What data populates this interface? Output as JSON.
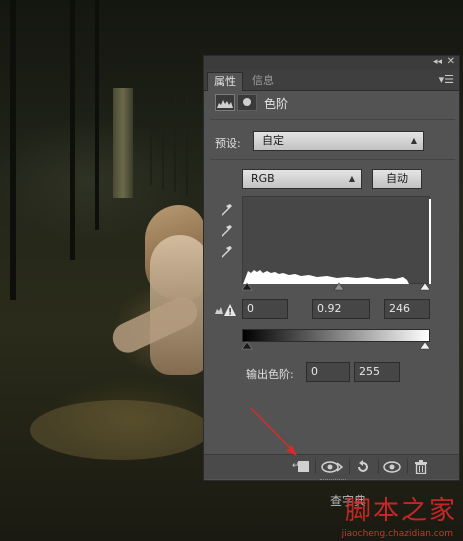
{
  "panel": {
    "tabs": [
      "属性",
      "信息"
    ],
    "title": "色阶",
    "preset_label": "预设:",
    "preset_value": "自定",
    "channel_value": "RGB",
    "auto_label": "自动",
    "input_levels": {
      "black": "0",
      "gamma": "0.92",
      "white": "246"
    },
    "output_label": "输出色阶:",
    "output_levels": {
      "black": "0",
      "white": "255"
    },
    "icons": {
      "collapse": "double-chevron-icon",
      "close": "close-icon",
      "menu": "panel-menu-icon",
      "levels": "levels-adjustment-icon",
      "mask": "layer-mask-icon",
      "eyedroppers": [
        "black-point-eyedropper-icon",
        "gray-point-eyedropper-icon",
        "white-point-eyedropper-icon"
      ],
      "clip_warning": "clipping-warning-icon",
      "bottom": [
        "clip-to-layer-icon",
        "view-previous-state-icon",
        "reset-icon",
        "visibility-eye-icon",
        "trash-icon"
      ]
    }
  },
  "watermark": {
    "text": "脚本之家",
    "sub": "jiaocheng.chazidian.com",
    "tag": "查字典"
  },
  "colors": {
    "panel_bg": "#535353",
    "tab_bar": "#3f3f3f",
    "annotation_arrow": "#d62b2b",
    "watermark": "#d8282a"
  }
}
